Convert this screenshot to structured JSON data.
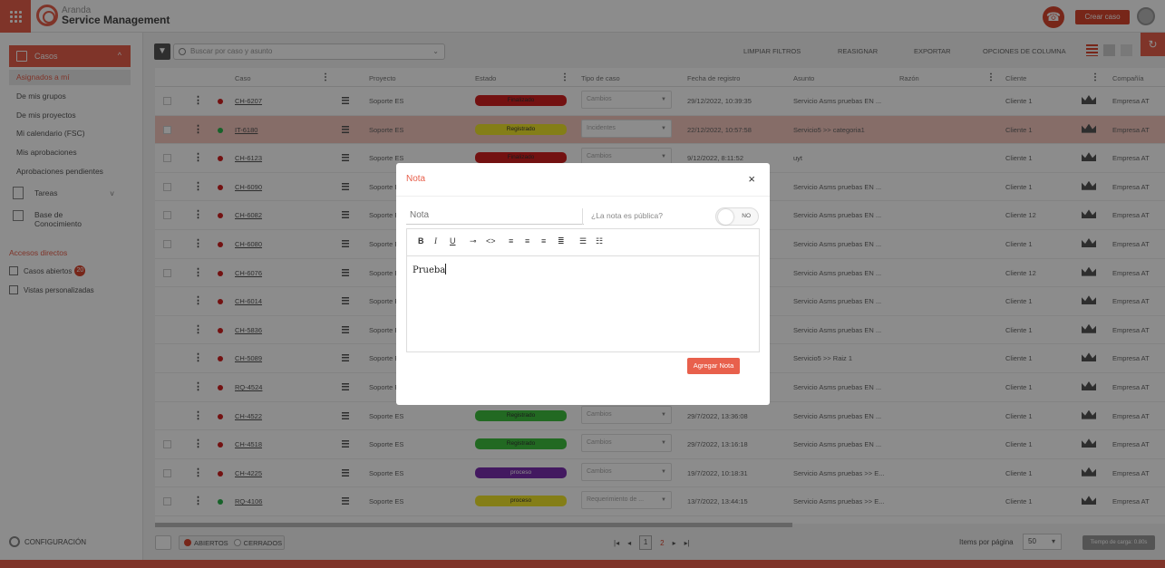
{
  "header": {
    "brand_top": "Aranda",
    "brand_bottom": "Service Management",
    "create_label": "Crear caso"
  },
  "sidebar": {
    "casos_label": "Casos",
    "items": [
      {
        "label": "Asignados a mí"
      },
      {
        "label": "De mis grupos"
      },
      {
        "label": "De mis proyectos"
      },
      {
        "label": "Mi calendario (FSC)"
      },
      {
        "label": "Mis aprobaciones"
      },
      {
        "label": "Aprobaciones pendientes"
      }
    ],
    "tareas_label": "Tareas",
    "knowledge_label_1": "Base de",
    "knowledge_label_2": "Conocimiento",
    "shortcuts_title": "Accesos directos",
    "open_cases_label": "Casos abiertos",
    "open_cases_count": "20",
    "custom_views_label": "Vistas personalizadas",
    "config_label": "CONFIGURACIÓN"
  },
  "toolbar": {
    "search_placeholder": "Buscar por caso y asunto",
    "clear_filters": "LIMPIAR FILTROS",
    "reassign": "REASIGNAR",
    "export": "EXPORTAR",
    "column_options": "OPCIONES DE COLUMNA"
  },
  "columns": {
    "caso": "Caso",
    "proyecto": "Proyecto",
    "estado": "Estado",
    "tipo": "Tipo de caso",
    "fecha": "Fecha de registro",
    "asunto": "Asunto",
    "razon": "Razón",
    "cliente": "Cliente",
    "compania": "Compañía"
  },
  "rows": [
    {
      "caso": "CH-6207",
      "proyecto": "Soporte ES",
      "estado": "Finalizado",
      "estado_color": "#d21f1f",
      "tipo": "Cambios",
      "fecha": "29/12/2022, 10:39:35",
      "asunto": "Servicio Asms pruebas EN ...",
      "cliente": "Cliente 1",
      "compania": "Empresa AT",
      "dot": "#d21f1f"
    },
    {
      "caso": "IT-6180",
      "proyecto": "Soporte ES",
      "estado": "Registrado",
      "estado_color": "#f0e52a",
      "tipo": "Incidentes",
      "fecha": "22/12/2022, 10:57:58",
      "asunto": "Servicio5 >> categoria1",
      "cliente": "Cliente 1",
      "compania": "Empresa AT",
      "dot": "#2bb24c"
    },
    {
      "caso": "CH-6123",
      "proyecto": "Soporte ES",
      "estado": "Finalizado",
      "estado_color": "#d21f1f",
      "tipo": "Cambios",
      "fecha": "9/12/2022, 8:11:52",
      "asunto": "uyt",
      "cliente": "Cliente 1",
      "compania": "Empresa AT",
      "dot": "#d21f1f"
    },
    {
      "caso": "CH-6090",
      "proyecto": "Soporte ES",
      "estado": "",
      "estado_color": "",
      "tipo": "",
      "fecha": "",
      "asunto": "Servicio Asms pruebas EN ...",
      "cliente": "Cliente 1",
      "compania": "Empresa AT",
      "dot": "#d21f1f"
    },
    {
      "caso": "CH-6082",
      "proyecto": "Soporte ES",
      "estado": "",
      "estado_color": "",
      "tipo": "",
      "fecha": "",
      "asunto": "Servicio Asms pruebas EN ...",
      "cliente": "Cliente 12",
      "compania": "Empresa AT",
      "dot": "#d21f1f"
    },
    {
      "caso": "CH-6080",
      "proyecto": "Soporte ES",
      "estado": "",
      "estado_color": "",
      "tipo": "",
      "fecha": "",
      "asunto": "Servicio Asms pruebas EN ...",
      "cliente": "Cliente 1",
      "compania": "Empresa AT",
      "dot": "#d21f1f"
    },
    {
      "caso": "CH-6076",
      "proyecto": "Soporte ES",
      "estado": "",
      "estado_color": "",
      "tipo": "",
      "fecha": "",
      "asunto": "Servicio Asms pruebas EN ...",
      "cliente": "Cliente 12",
      "compania": "Empresa AT",
      "dot": "#d21f1f"
    },
    {
      "caso": "CH-6014",
      "proyecto": "Soporte ES",
      "estado": "",
      "estado_color": "",
      "tipo": "",
      "fecha": "",
      "asunto": "Servicio Asms pruebas EN ...",
      "cliente": "Cliente 1",
      "compania": "Empresa AT",
      "dot": "#d21f1f"
    },
    {
      "caso": "CH-5836",
      "proyecto": "Soporte ES",
      "estado": "",
      "estado_color": "",
      "tipo": "",
      "fecha": "",
      "asunto": "Servicio Asms pruebas EN ...",
      "cliente": "Cliente 1",
      "compania": "Empresa AT",
      "dot": "#d21f1f"
    },
    {
      "caso": "CH-5089",
      "proyecto": "Soporte ES",
      "estado": "",
      "estado_color": "",
      "tipo": "",
      "fecha": "",
      "asunto": "Servicio5 >> Raiz 1",
      "cliente": "Cliente 1",
      "compania": "Empresa AT",
      "dot": "#d21f1f"
    },
    {
      "caso": "RQ-4524",
      "proyecto": "Soporte ES",
      "estado": "",
      "estado_color": "",
      "tipo": "",
      "fecha": "",
      "asunto": "Servicio Asms pruebas EN ...",
      "cliente": "Cliente 1",
      "compania": "Empresa AT",
      "dot": "#d21f1f"
    },
    {
      "caso": "CH-4522",
      "proyecto": "Soporte ES",
      "estado": "Registrado",
      "estado_color": "#3fbf3f",
      "tipo": "Cambios",
      "fecha": "29/7/2022, 13:36:08",
      "asunto": "Servicio Asms pruebas EN ...",
      "cliente": "Cliente 1",
      "compania": "Empresa AT",
      "dot": "#d21f1f"
    },
    {
      "caso": "CH-4518",
      "proyecto": "Soporte ES",
      "estado": "Registrado",
      "estado_color": "#3fbf3f",
      "tipo": "Cambios",
      "fecha": "29/7/2022, 13:16:18",
      "asunto": "Servicio Asms pruebas EN ...",
      "cliente": "Cliente 1",
      "compania": "Empresa AT",
      "dot": "#d21f1f"
    },
    {
      "caso": "CH-4225",
      "proyecto": "Soporte ES",
      "estado": "proceso",
      "estado_color": "#7a2fb0",
      "tipo": "Cambios",
      "fecha": "19/7/2022, 10:18:31",
      "asunto": "Servicio Asms pruebas >> E...",
      "cliente": "Cliente 1",
      "compania": "Empresa AT",
      "dot": "#d21f1f"
    },
    {
      "caso": "RQ-4106",
      "proyecto": "Soporte ES",
      "estado": "proceso",
      "estado_color": "#f0e52a",
      "tipo": "Requerimiento de ...",
      "fecha": "13/7/2022, 13:44:15",
      "asunto": "Servicio Asms pruebas >> E...",
      "cliente": "Cliente 1",
      "compania": "Empresa AT",
      "dot": "#2bb24c"
    }
  ],
  "footer": {
    "abiertos": "ABIERTOS",
    "cerrados": "CERRADOS",
    "page1": "1",
    "page2": "2",
    "items_per_page": "Items por página",
    "page_size": "50",
    "load_time": "Tiempo de carga: 0.80s"
  },
  "modal": {
    "title": "Nota",
    "close": "×",
    "nota_placeholder": "Nota",
    "public_question": "¿La nota es pública?",
    "toggle_value": "NO",
    "body_text": "Prueba",
    "submit": "Agregar Nota"
  }
}
